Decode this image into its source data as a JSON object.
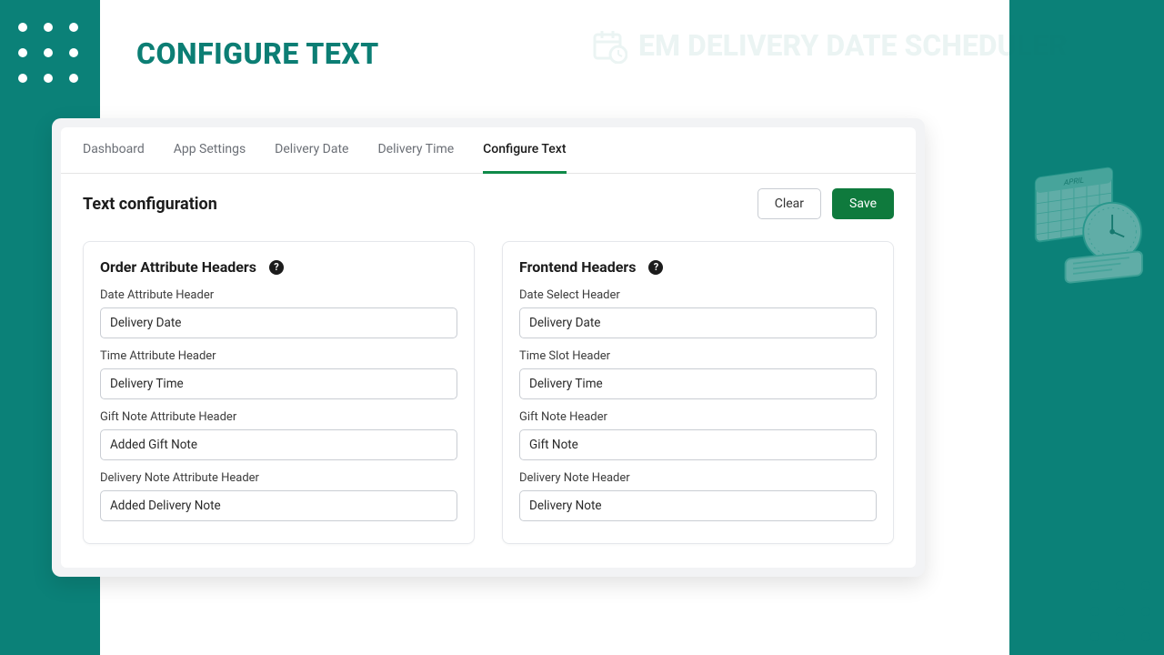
{
  "page": {
    "title": "CONFIGURE TEXT"
  },
  "brand": {
    "name": "EM DELIVERY DATE SCHEDULER"
  },
  "tabs": [
    {
      "label": "Dashboard",
      "active": false
    },
    {
      "label": "App Settings",
      "active": false
    },
    {
      "label": "Delivery Date",
      "active": false
    },
    {
      "label": "Delivery Time",
      "active": false
    },
    {
      "label": "Configure Text",
      "active": true
    }
  ],
  "section": {
    "title": "Text configuration",
    "clear": "Clear",
    "save": "Save"
  },
  "panels": {
    "left": {
      "title": "Order Attribute Headers",
      "fields": [
        {
          "label": "Date Attribute Header",
          "value": "Delivery Date"
        },
        {
          "label": "Time Attribute Header",
          "value": "Delivery Time"
        },
        {
          "label": "Gift Note Attribute Header",
          "value": "Added Gift Note"
        },
        {
          "label": "Delivery Note Attribute Header",
          "value": "Added Delivery Note"
        }
      ]
    },
    "right": {
      "title": "Frontend Headers",
      "fields": [
        {
          "label": "Date Select Header",
          "value": "Delivery Date"
        },
        {
          "label": "Time Slot Header",
          "value": "Delivery Time"
        },
        {
          "label": "Gift Note Header",
          "value": "Gift Note"
        },
        {
          "label": "Delivery Note Header",
          "value": "Delivery Note"
        }
      ]
    }
  }
}
